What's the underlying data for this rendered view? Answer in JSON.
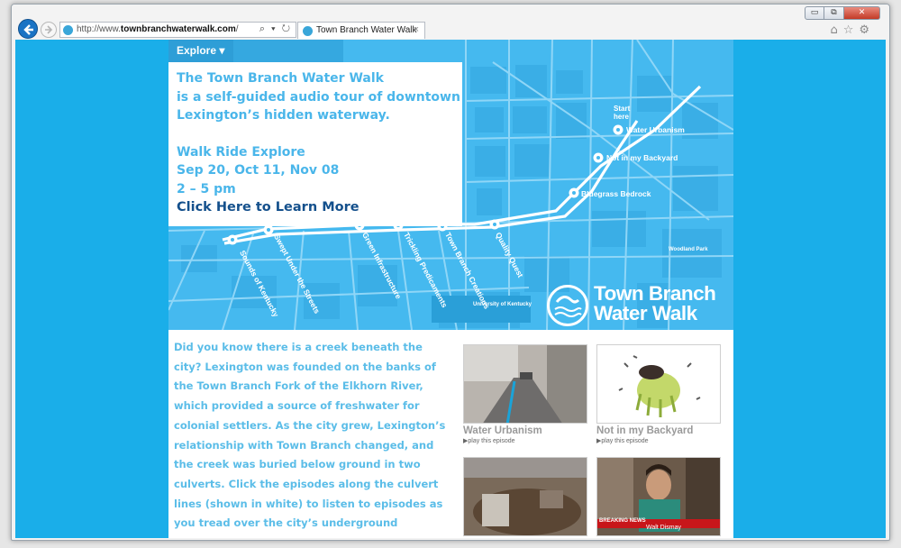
{
  "browser": {
    "url_prefix": "http://www.",
    "url_domain": "townbranchwaterwalk.com",
    "url_suffix": "/",
    "address_tools": "⌕ ▾ ↻",
    "tab_title": "Town Branch Water Walk",
    "tab_close": "×",
    "window_minimize": "▭",
    "window_maximize": "⧉",
    "window_close": "✕",
    "toolbar_icons": "⌂☆⚙"
  },
  "nav": {
    "explore_label": "Explore ▾"
  },
  "promo": {
    "line1": "The Town Branch Water Walk",
    "line2": "is a self-guided audio tour of downtown",
    "line3": "Lexington’s hidden waterway.",
    "event_title": "Walk Ride Explore",
    "event_dates": "Sep 20, Oct 11, Nov 08",
    "event_time": "2 – 5 pm",
    "cta": "Click Here to Learn More"
  },
  "map": {
    "start_label_1": "Start",
    "start_label_2": "here",
    "episode_labels": {
      "water_urbanism": "Water Urbanism",
      "not_in_my_backyard": "Not in my Backyard",
      "bluegrass_bedrock": "Bluegrass Bedrock",
      "sounds_of_kentucky": "Sounds of Kentucky",
      "swept_under": "Swept Under the Streets",
      "green_infrastructure": "Green Infrastructure",
      "trickling": "Trickling Predicaments",
      "town_branch_creations": "Town Branch Creations",
      "quality": "Quality Quest"
    },
    "places": {
      "university": "University of Kentucky",
      "woodland": "Woodland Park"
    }
  },
  "logo": {
    "line1": "Town Branch",
    "line2": "Water Walk"
  },
  "story": {
    "text": "Did you know there is a creek beneath the city? Lexington was founded on the banks of the Town Branch Fork of the Elkhorn River, which provided a source of freshwater for colonial settlers. As the city grew, Lexington’s relationship with Town Branch changed, and the creek was buried below ground in two culverts. Click the episodes along the culvert lines (shown in white) to listen to episodes as you tread over the city’s underground stormwater system to investigate the history,"
  },
  "episodes": [
    {
      "title": "Water Urbanism",
      "play": "▶play this episode"
    },
    {
      "title": "Not in my Backyard",
      "play": "▶play this episode"
    },
    {
      "title": "",
      "play": ""
    },
    {
      "title": "",
      "play": "",
      "news_banner": "BREAKING NEWS",
      "news_name": "Walt Dismay"
    }
  ],
  "colors": {
    "page_bg": "#1aaee9",
    "map_blue": "#45b9ef",
    "promo_text": "#4ab6ea",
    "cta_text": "#14508c"
  }
}
